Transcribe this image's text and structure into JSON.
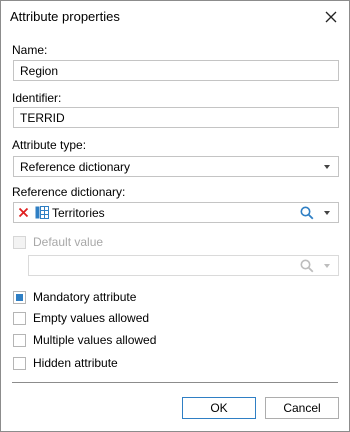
{
  "dialog": {
    "title": "Attribute properties",
    "close_icon": "close-icon"
  },
  "name": {
    "label": "Name:",
    "value": "Region"
  },
  "identifier": {
    "label": "Identifier:",
    "value": "TERRID"
  },
  "attribute_type": {
    "label": "Attribute type:",
    "value": "Reference dictionary"
  },
  "reference_dictionary": {
    "label": "Reference dictionary:",
    "value": "Territories",
    "clear_icon": "clear-x-icon",
    "dictionary_icon": "dictionary-table-icon",
    "search_icon": "search-icon",
    "accent_color": "#2f7fc4",
    "clear_color": "#e02020"
  },
  "default_value": {
    "label": "Default value",
    "checked": false,
    "enabled": false,
    "value": ""
  },
  "options": {
    "mandatory": {
      "label": "Mandatory attribute",
      "checked": true
    },
    "empty_values": {
      "label": "Empty values allowed",
      "checked": false
    },
    "multiple_values": {
      "label": "Multiple values allowed",
      "checked": false
    },
    "hidden": {
      "label": "Hidden attribute",
      "checked": false
    }
  },
  "buttons": {
    "ok": "OK",
    "cancel": "Cancel"
  }
}
